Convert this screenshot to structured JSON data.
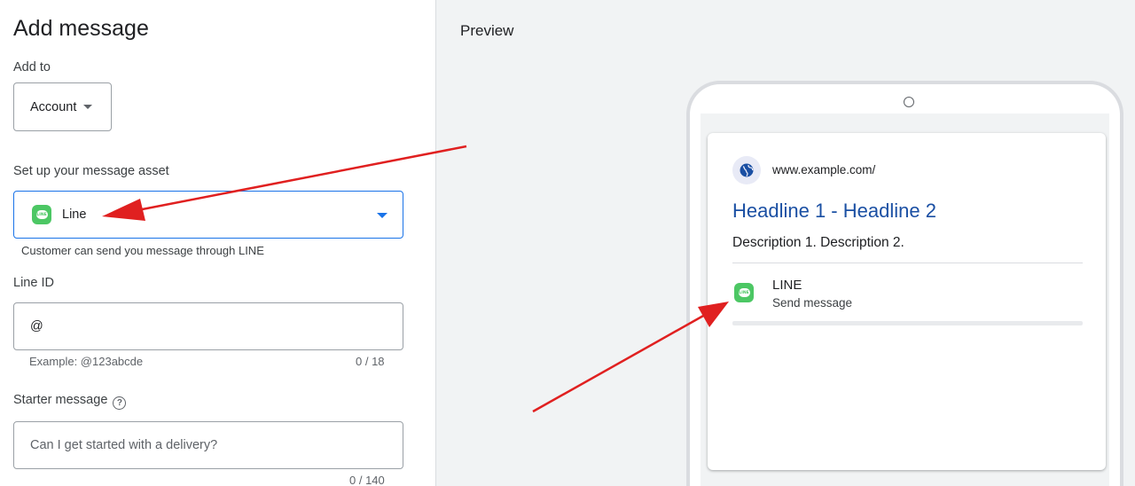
{
  "form": {
    "title": "Add message",
    "add_to_label": "Add to",
    "account_value": "Account",
    "setup_label": "Set up your message asset",
    "asset_type": "Line",
    "asset_helper": "Customer can send you message through LINE",
    "line_id_label": "Line ID",
    "line_id_value": "@",
    "line_id_hint": "Example: @123abcde",
    "line_id_counter": "0 / 18",
    "starter_label": "Starter message",
    "starter_placeholder": "Can I get started with a delivery?",
    "starter_counter": "0 / 140"
  },
  "preview": {
    "title": "Preview",
    "url": "www.example.com/",
    "headline": "Headline 1 - Headline 2",
    "description": "Description 1. Description 2.",
    "asset_title": "LINE",
    "asset_subtitle": "Send message",
    "line_logo_text": "LINE"
  },
  "colors": {
    "accent": "#1a73e8",
    "line_green": "#4cc764",
    "headline_blue": "#1a4fa3",
    "annotation_red": "#e02020"
  },
  "icons": {
    "dropdown": "caret-down-icon",
    "help": "help-circle-icon",
    "globe": "globe-icon",
    "line": "line-app-icon"
  }
}
